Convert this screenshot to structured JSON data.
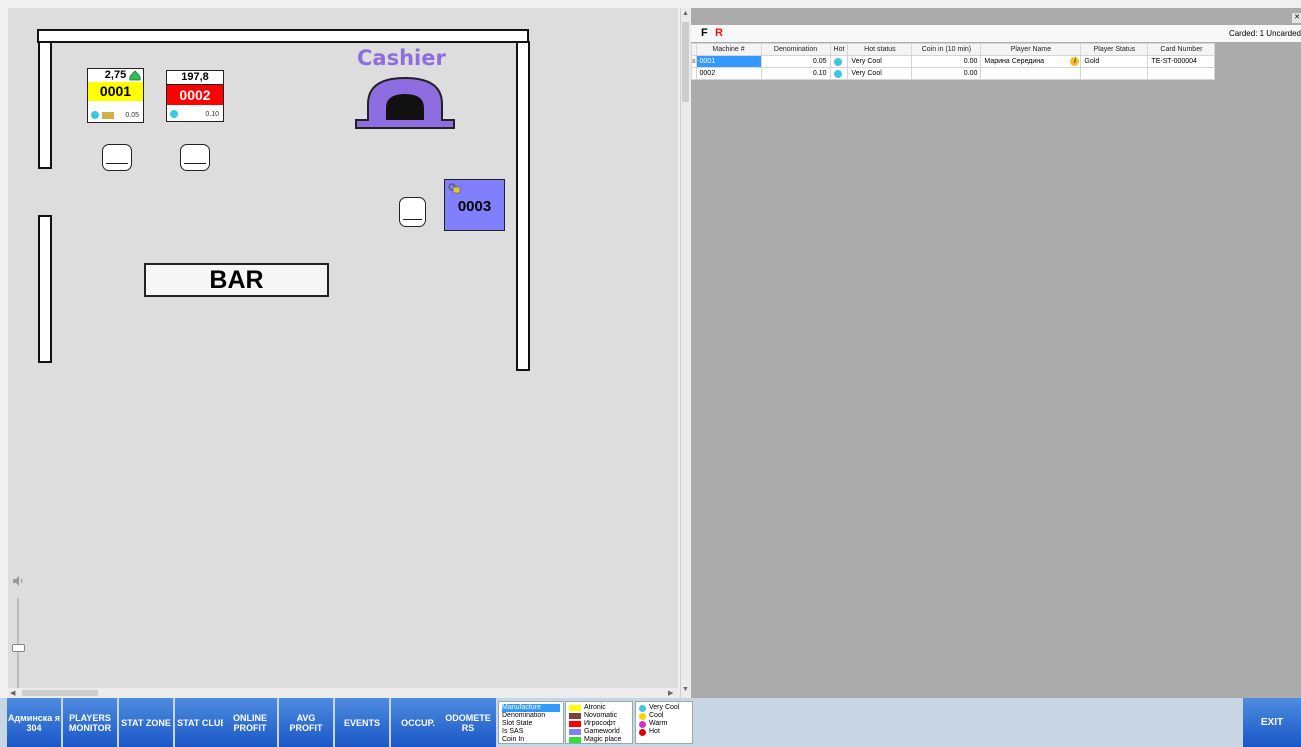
{
  "floor": {
    "cashier_label": "Cashier",
    "bar_label": "BAR",
    "machines": [
      {
        "id": "0001",
        "top_value": "2,75",
        "denomination": "0.05",
        "color": "#ffff00"
      },
      {
        "id": "0002",
        "top_value": "197,8",
        "denomination": "0.10",
        "color": "#ff0000"
      },
      {
        "id": "0003",
        "color": "#8080ff"
      }
    ]
  },
  "panel": {
    "toolbar": {
      "f_label": "F",
      "r_label": "R",
      "carded_text": "Carded: 1 Uncarded"
    },
    "columns": [
      "Machine #",
      "Denomination",
      "Hot",
      "Hot status",
      "Coin in (10 min)",
      "Player Name",
      "Player Status",
      "Card Number"
    ],
    "rows": [
      {
        "machine": "0001",
        "denomination": "0.05",
        "hot_status": "Very Cool",
        "coin_in": "0.00",
        "player_name": "Марина Середина",
        "player_status": "Gold",
        "card_number": "TE-ST-000004"
      },
      {
        "machine": "0002",
        "denomination": "0.10",
        "hot_status": "Very Cool",
        "coin_in": "0.00",
        "player_name": "",
        "player_status": "",
        "card_number": ""
      }
    ]
  },
  "nav": {
    "buttons": [
      {
        "label": "Админска я 304"
      },
      {
        "label": "PLAYERS MONITOR"
      },
      {
        "label": "STAT ZONE"
      },
      {
        "label": "STAT CLUB"
      },
      {
        "label": "ONLINE PROFIT"
      },
      {
        "label": "AVG PROFIT"
      },
      {
        "label": "EVENTS"
      },
      {
        "label": "OCCUP."
      },
      {
        "label": "ODOMETE RS"
      }
    ],
    "exit_label": "EXIT"
  },
  "legend": {
    "modes": [
      "Manufacture",
      "Denomination",
      "Slot State",
      "Is SAS",
      "Coin In"
    ],
    "selected_mode": "Manufacture",
    "manufacturers": [
      {
        "label": "Atronic",
        "color": "#ffff00"
      },
      {
        "label": "Novomatic",
        "color": "#804040"
      },
      {
        "label": "Игрософт",
        "color": "#ff0000"
      },
      {
        "label": "Gameworld",
        "color": "#8080ff"
      },
      {
        "label": "Magic place",
        "color": "#33dd33"
      }
    ],
    "hot_states": [
      {
        "label": "Very Cool",
        "color": "#3cc8e0"
      },
      {
        "label": "Cool",
        "color": "#ffd700"
      },
      {
        "label": "Warm",
        "color": "#cc33cc"
      },
      {
        "label": "Hot",
        "color": "#dd0000"
      }
    ]
  }
}
